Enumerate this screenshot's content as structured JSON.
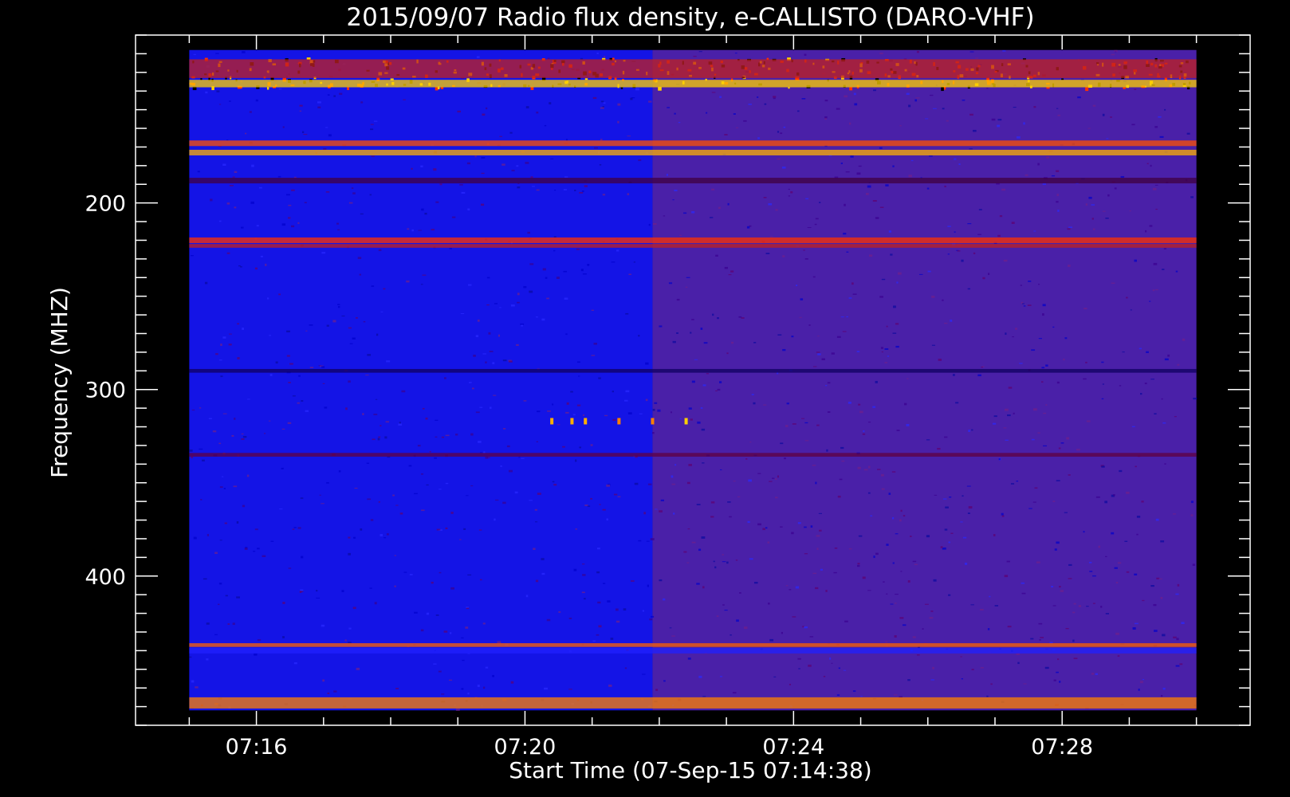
{
  "chart_data": {
    "type": "heatmap",
    "title": "2015/09/07  Radio flux density, e-CALLISTO (DARO-VHF)",
    "xlabel": "Start Time (07-Sep-15 07:14:38)",
    "ylabel": "Frequency (MHZ)",
    "x_tick_labels": [
      "07:16",
      "07:20",
      "07:24",
      "07:28"
    ],
    "x_tick_minutes": [
      16,
      20,
      24,
      28
    ],
    "x_minor_step_minutes": 1,
    "xlim_minutes": [
      14.2,
      30.8
    ],
    "data_x_range_minutes": [
      15.0,
      30.0
    ],
    "y_tick_labels": [
      "200",
      "300",
      "400"
    ],
    "y_tick_values": [
      200,
      300,
      400
    ],
    "y_minor_step": 10,
    "ylim": [
      110,
      480
    ],
    "y_reversed": true,
    "data_y_range": [
      118,
      472
    ],
    "grid": false,
    "colormap": [
      "#000000",
      "#0000ff",
      "#800080",
      "#ff0000",
      "#ff8000",
      "#ffff00",
      "#ffffff"
    ],
    "regime_change_minute": 21.9,
    "base_colors": {
      "before": "#1414e6",
      "after": "#4a20a8"
    },
    "bright_bands_mhz": [
      {
        "freq": 128,
        "width": 10,
        "color": "#c02020"
      },
      {
        "freq": 136,
        "width": 4,
        "color": "#ffd000"
      },
      {
        "freq": 168,
        "width": 3,
        "color": "#ff5000"
      },
      {
        "freq": 173,
        "width": 3,
        "color": "#ffb000"
      },
      {
        "freq": 188,
        "width": 3,
        "color": "#400040"
      },
      {
        "freq": 220,
        "width": 3,
        "color": "#ff3000"
      },
      {
        "freq": 223,
        "width": 2,
        "color": "#c02020"
      },
      {
        "freq": 290,
        "width": 2,
        "color": "#100060"
      },
      {
        "freq": 335,
        "width": 2,
        "color": "#600040"
      },
      {
        "freq": 437,
        "width": 2,
        "color": "#ff6000"
      },
      {
        "freq": 440,
        "width": 3,
        "color": "#2020ff"
      },
      {
        "freq": 468,
        "width": 6,
        "color": "#ff8000"
      }
    ],
    "bursts": [
      {
        "minute": 20.4,
        "freq": 317,
        "color": "#ffb000"
      },
      {
        "minute": 20.7,
        "freq": 317,
        "color": "#ffb000"
      },
      {
        "minute": 20.9,
        "freq": 317,
        "color": "#ffb000"
      },
      {
        "minute": 21.4,
        "freq": 317,
        "color": "#ff8000"
      },
      {
        "minute": 21.9,
        "freq": 317,
        "color": "#ff8000"
      },
      {
        "minute": 22.4,
        "freq": 317,
        "color": "#ffd000"
      }
    ]
  }
}
